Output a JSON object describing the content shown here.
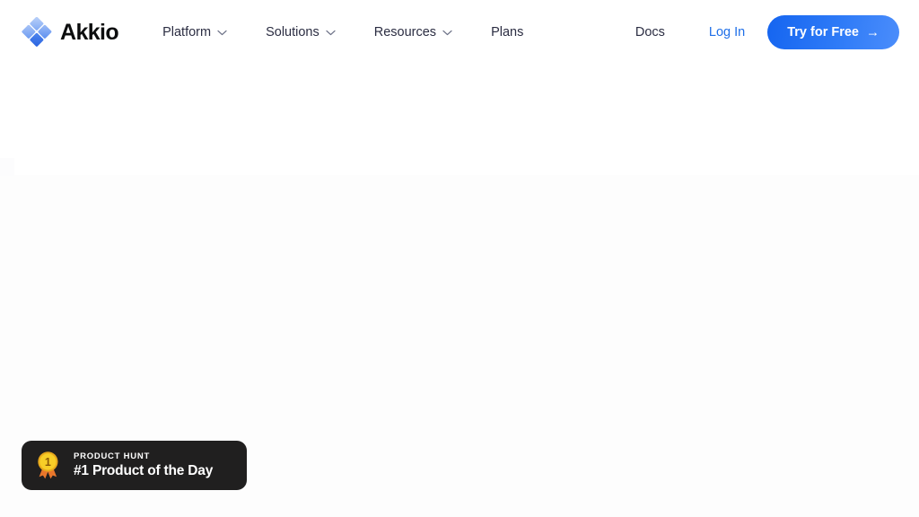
{
  "brand": {
    "name": "Akkio",
    "logo_icon": "akkio-diamond-logo-icon",
    "logo_colors": [
      "#7ba6f2",
      "#a8c4f7",
      "#2f6fe8",
      "#5b93f0"
    ]
  },
  "header": {
    "nav": [
      {
        "label": "Platform",
        "has_dropdown": true,
        "icon": "chevron-down-icon"
      },
      {
        "label": "Solutions",
        "has_dropdown": true,
        "icon": "chevron-down-icon"
      },
      {
        "label": "Resources",
        "has_dropdown": true,
        "icon": "chevron-down-icon"
      },
      {
        "label": "Plans",
        "has_dropdown": false,
        "icon": ""
      }
    ],
    "docs_label": "Docs",
    "login_label": "Log In",
    "cta_label": "Try for Free",
    "cta_arrow": "→",
    "cta_color_start": "#1565f0",
    "cta_color_end": "#4b8dfb",
    "link_color": "#1f6fe8",
    "nav_text_color": "#2b2d42"
  },
  "badge": {
    "icon": "product-hunt-medal-icon",
    "kicker": "PRODUCT HUNT",
    "title": "#1 Product of the Day",
    "background_color": "#201f1f",
    "medal_color": "#f5c518",
    "ribbon_color": "#e8762c"
  }
}
